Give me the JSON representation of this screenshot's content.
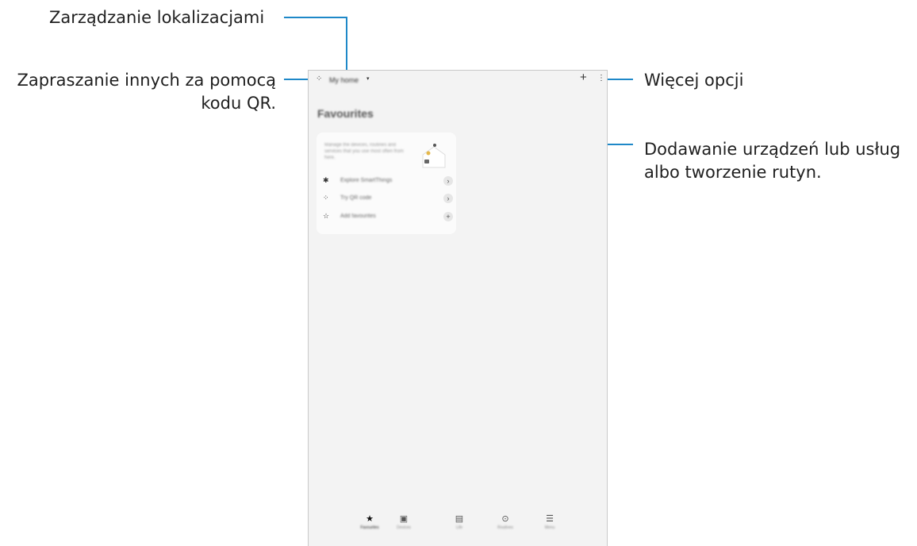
{
  "callouts": {
    "manage_locations": "Zarządzanie lokalizacjami",
    "invite_qr_line1": "Zapraszanie innych za pomocą",
    "invite_qr_line2": "kodu QR.",
    "more_options": "Więcej opcji",
    "add_devices_line1": "Dodawanie urządzeń lub usług",
    "add_devices_line2": "albo tworzenie rutyn."
  },
  "app": {
    "location": "My home",
    "section_title": "Favourites",
    "card": {
      "description": "Manage the devices, routines and services that you use most often from here.",
      "items": [
        {
          "label": "Explore SmartThings",
          "icon": "sparkle-icon",
          "action": "chevron-right-icon"
        },
        {
          "label": "Try QR code",
          "icon": "qr-icon",
          "action": "chevron-right-icon"
        },
        {
          "label": "Add favourites",
          "icon": "star-outline-icon",
          "action": "plus-icon"
        }
      ]
    },
    "nav": [
      {
        "label": "Favourites",
        "icon": "star-icon"
      },
      {
        "label": "Devices",
        "icon": "devices-icon"
      },
      {
        "label": "Life",
        "icon": "life-icon"
      },
      {
        "label": "Routines",
        "icon": "play-circle-icon"
      },
      {
        "label": "Menu",
        "icon": "menu-icon"
      }
    ]
  },
  "colors": {
    "callout_line": "#1e88c8"
  }
}
